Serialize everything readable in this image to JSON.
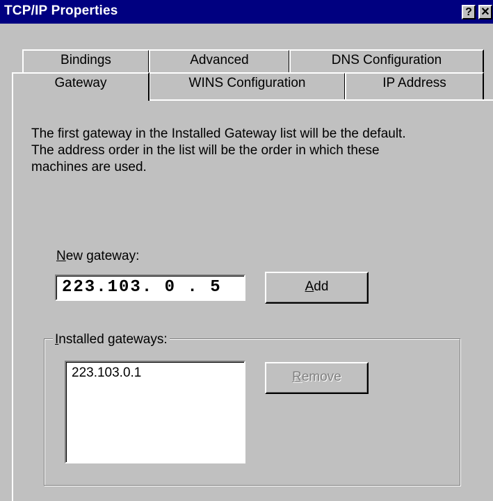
{
  "window": {
    "title": "TCP/IP Properties",
    "help_label": "?",
    "close_label": "✕"
  },
  "tabs": {
    "row1": [
      {
        "label": "Bindings"
      },
      {
        "label": "Advanced"
      },
      {
        "label": "DNS Configuration"
      }
    ],
    "row2": [
      {
        "label": "Gateway",
        "active": true
      },
      {
        "label": "WINS Configuration"
      },
      {
        "label": "IP Address"
      }
    ]
  },
  "gateway": {
    "description": [
      "The first gateway in the Installed Gateway list will be the default.",
      "The address order in the list will be the order in which these",
      "machines are used."
    ],
    "new_gateway_label": "New gateway:",
    "new_gateway_value": "223.103. 0 . 5",
    "add_label": "Add",
    "installed_label": "Installed gateways:",
    "installed_items": [
      "223.103.0.1"
    ],
    "remove_label": "Remove"
  },
  "colors": {
    "title_bar": "#000080",
    "face": "#c0c0c0",
    "disabled_text": "#808080"
  }
}
